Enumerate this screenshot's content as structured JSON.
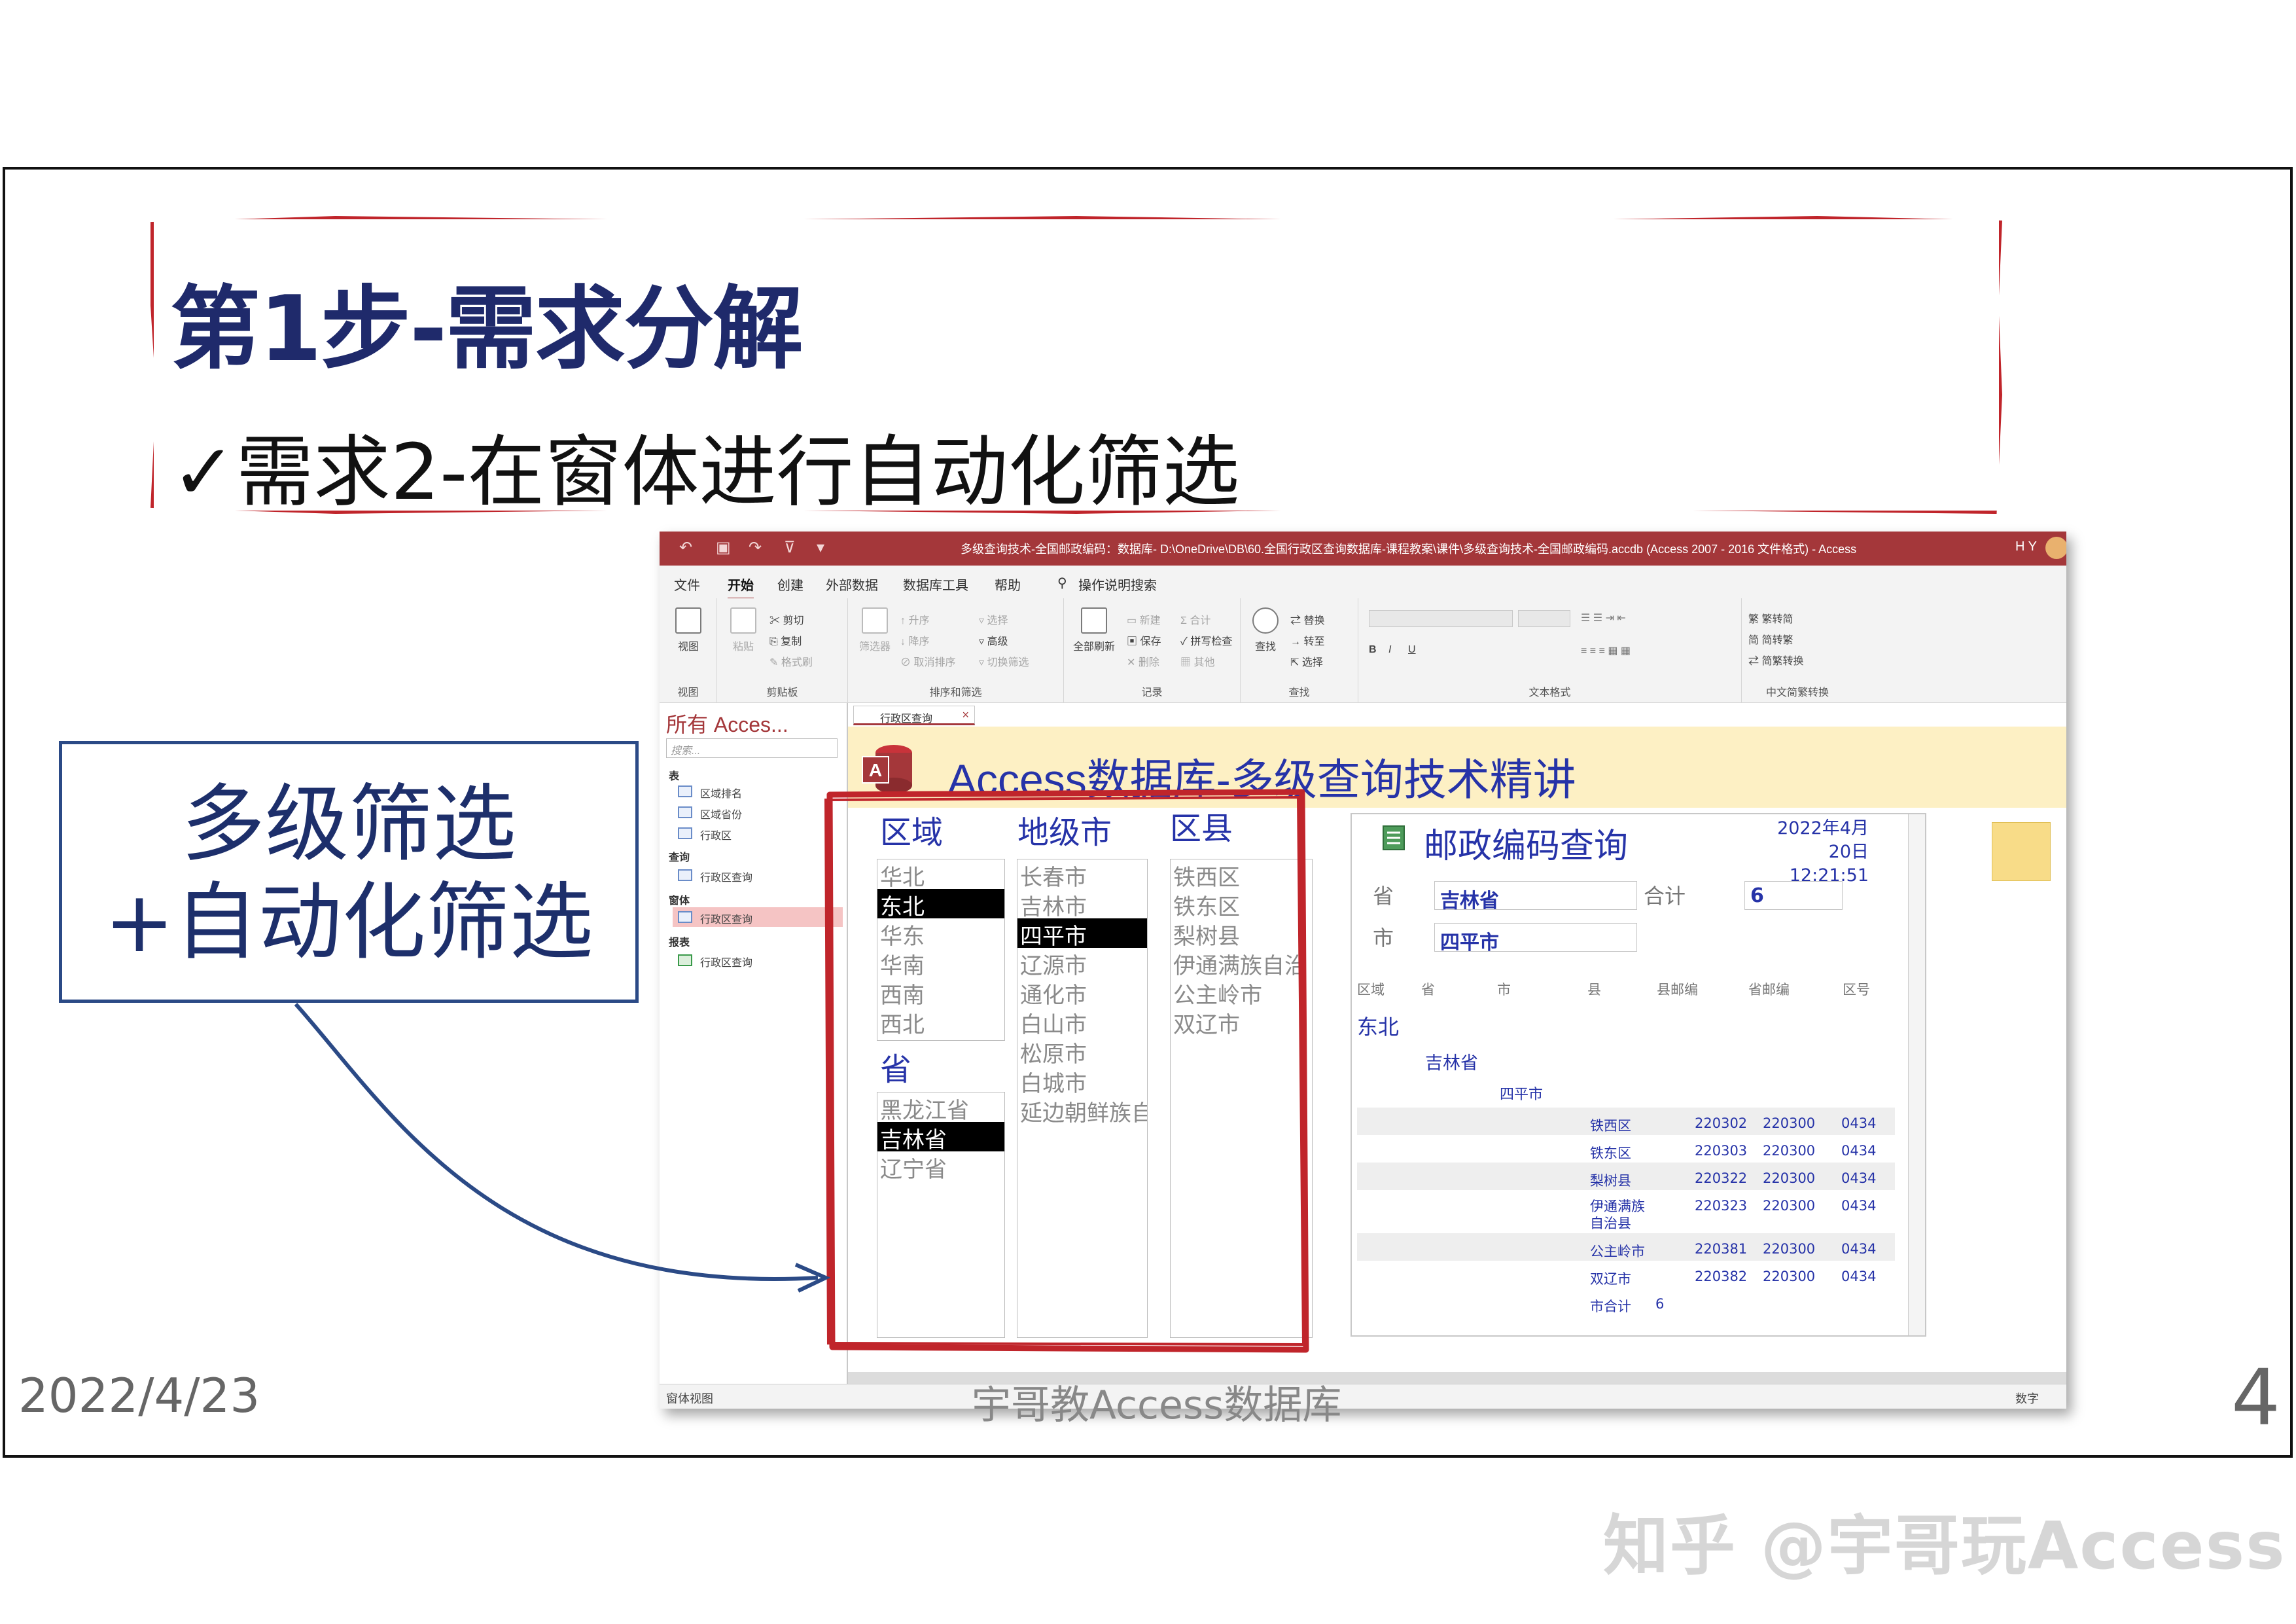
{
  "slide": {
    "title": "第1步-需求分解",
    "subtitle": "✓需求2-在窗体进行自动化筛选",
    "callout_line1": "多级筛选",
    "callout_line2": "+自动化筛选",
    "footer_date": "2022/4/23",
    "footer_center": "宇哥教Access数据库",
    "page_number": "4",
    "watermark": "知乎 @宇哥玩Access"
  },
  "window": {
    "title": "多级查询技术-全国邮政编码：数据库- D:\\OneDrive\\DB\\60.全国行政区查询数据库-课程教案\\课件\\多级查询技术-全国邮政编码.accdb (Access 2007 - 2016 文件格式) - Access",
    "user": "H Y",
    "menu": [
      "文件",
      "开始",
      "创建",
      "外部数据",
      "数据库工具",
      "帮助",
      "操作说明搜索"
    ],
    "ribbon": {
      "view_group": {
        "big": "视图",
        "label": "视图"
      },
      "clipboard": {
        "paste": "粘贴",
        "cut": "剪切",
        "copy": "复制",
        "format": "格式刷",
        "label": "剪贴板"
      },
      "sort_filter": {
        "filter": "筛选器",
        "asc": "升序",
        "desc": "降序",
        "clear": "取消排序",
        "select": "选择",
        "advanced": "高级",
        "toggle": "切换筛选",
        "label": "排序和筛选"
      },
      "records": {
        "refresh": "全部刷新",
        "new": "新建",
        "save": "保存",
        "delete": "删除",
        "total": "合计",
        "spell": "拼写检查",
        "more": "其他",
        "label": "记录"
      },
      "find": {
        "find": "查找",
        "replace": "替换",
        "goto": "转至",
        "select": "选择",
        "label": "查找"
      },
      "text": {
        "label": "文本格式",
        "bold": "B",
        "italic": "I",
        "underline": "U"
      },
      "chinese": {
        "t2s": "繁转简",
        "s2t": "简转繁",
        "conv": "简繁转换",
        "label": "中文简繁转换"
      }
    },
    "nav": {
      "header": "所有 Acces...",
      "search_placeholder": "搜索...",
      "sections": [
        {
          "title": "表",
          "items": [
            "区域排名",
            "区域省份",
            "行政区"
          ]
        },
        {
          "title": "查询",
          "items": [
            "行政区查询"
          ]
        },
        {
          "title": "窗体",
          "items": [
            "行政区查询"
          ]
        },
        {
          "title": "报表",
          "items": [
            "行政区查询"
          ]
        }
      ]
    },
    "doc_tab": "行政区查询",
    "form_title": "Access数据库-多级查询技术精讲",
    "filters": {
      "region_label": "区域",
      "city_label": "地级市",
      "county_label": "区县",
      "province_label": "省",
      "regions": [
        "华北",
        "东北",
        "华东",
        "华南",
        "西南",
        "西北"
      ],
      "region_selected": 1,
      "provinces": [
        "黑龙江省",
        "吉林省",
        "辽宁省"
      ],
      "province_selected": 1,
      "cities": [
        "长春市",
        "吉林市",
        "四平市",
        "辽源市",
        "通化市",
        "白山市",
        "松原市",
        "白城市",
        "延边朝鲜族自"
      ],
      "city_selected": 2,
      "counties": [
        "铁西区",
        "铁东区",
        "梨树县",
        "伊通满族自治",
        "公主岭市",
        "双辽市"
      ]
    },
    "report": {
      "title": "邮政编码查询",
      "date": "2022年4月20日",
      "time": "12:21:51",
      "province_label": "省",
      "province_value": "吉林省",
      "total_label": "合计",
      "total_value": "6",
      "city_label": "市",
      "city_value": "四平市",
      "columns": [
        "区域",
        "省",
        "市",
        "县",
        "县邮编",
        "省邮编",
        "区号"
      ],
      "group_region": "东北",
      "group_province": "吉林省",
      "group_city": "四平市",
      "rows": [
        {
          "county": "铁西区",
          "code": "220302",
          "prov_code": "220300",
          "area": "0434"
        },
        {
          "county": "铁东区",
          "code": "220303",
          "prov_code": "220300",
          "area": "0434"
        },
        {
          "county": "梨树县",
          "code": "220322",
          "prov_code": "220300",
          "area": "0434"
        },
        {
          "county": "伊通满族自治县",
          "code": "220323",
          "prov_code": "220300",
          "area": "0434"
        },
        {
          "county": "公主岭市",
          "code": "220381",
          "prov_code": "220300",
          "area": "0434"
        },
        {
          "county": "双辽市",
          "code": "220382",
          "prov_code": "220300",
          "area": "0434"
        }
      ],
      "subtotal_label": "市合计",
      "subtotal_value": "6"
    },
    "status_left": "窗体视图",
    "status_right": "数字"
  },
  "colors": {
    "access_red": "#a4373a",
    "form_blue": "#2633a8",
    "highlight": "#c0252b",
    "header_bg": "#fdf0c4"
  }
}
